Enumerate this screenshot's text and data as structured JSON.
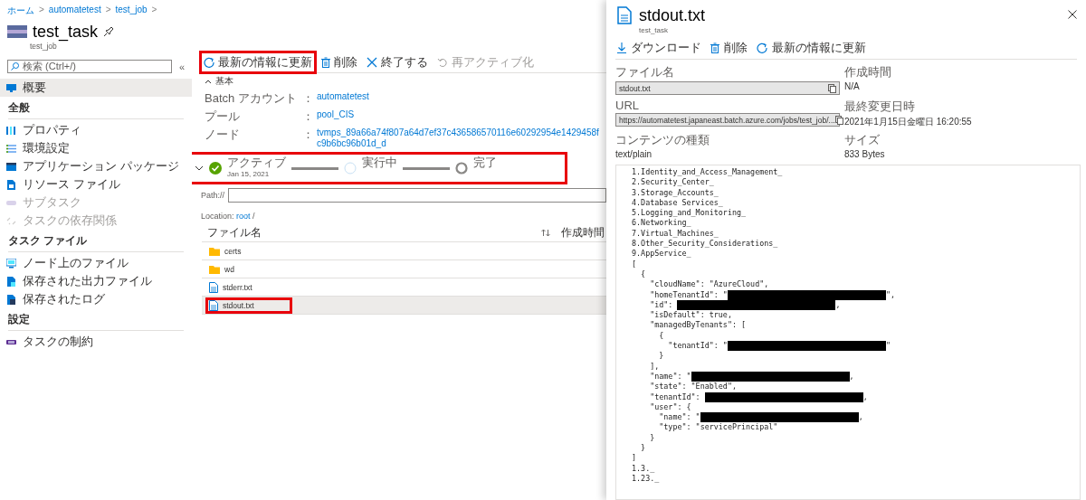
{
  "breadcrumb": [
    {
      "label": "ホーム",
      "separator": ">"
    },
    {
      "label": "automatetest",
      "separator": ">"
    },
    {
      "label": "test_job",
      "separator": ">"
    }
  ],
  "blade": {
    "title": "test_task",
    "subtitle": "test_job"
  },
  "sidebar": {
    "search_placeholder": "検索 (Ctrl+/)",
    "collapse": "«",
    "sections": [
      {
        "items": [
          {
            "label": "概要",
            "selected": true,
            "disabled": false
          }
        ]
      },
      {
        "heading": "全般",
        "items": [
          {
            "label": "プロパティ",
            "selected": false,
            "disabled": false
          },
          {
            "label": "環境設定",
            "selected": false,
            "disabled": false
          },
          {
            "label": "アプリケーション パッケージ",
            "selected": false,
            "disabled": false
          },
          {
            "label": "リソース ファイル",
            "selected": false,
            "disabled": false
          },
          {
            "label": "サブタスク",
            "selected": false,
            "disabled": true
          },
          {
            "label": "タスクの依存関係",
            "selected": false,
            "disabled": true
          }
        ]
      },
      {
        "heading": "タスク ファイル",
        "items": [
          {
            "label": "ノード上のファイル",
            "selected": false,
            "disabled": false
          },
          {
            "label": "保存された出力ファイル",
            "selected": false,
            "disabled": false
          },
          {
            "label": "保存されたログ",
            "selected": false,
            "disabled": false
          }
        ]
      },
      {
        "heading": "設定",
        "items": [
          {
            "label": "タスクの制約",
            "selected": false,
            "disabled": false
          }
        ]
      }
    ]
  },
  "main": {
    "toolbar": [
      {
        "label": "最新の情報に更新",
        "disabled": false,
        "highlighted": true
      },
      {
        "label": "削除",
        "disabled": false,
        "highlighted": false
      },
      {
        "label": "終了する",
        "disabled": false,
        "highlighted": false
      },
      {
        "label": "再アクティブ化",
        "disabled": true,
        "highlighted": false
      }
    ],
    "essentials": {
      "heading": "基本",
      "expanded": true,
      "fields": [
        {
          "label": "Batch アカウント",
          "separator": "：",
          "value": "automatetest"
        },
        {
          "label": "プール",
          "separator": "：",
          "value": "pool_CIS"
        },
        {
          "label": "ノード",
          "separator": "：",
          "value": "tvmps_89a66a74f807a64d7ef37c436586570116e60292954e1429458fc9b6bc96b01d_d"
        }
      ]
    },
    "status": {
      "expanded": false,
      "highlighted": true,
      "steps": [
        {
          "label": "アクティブ",
          "date": "Jan 15, 2021",
          "kind": "complete"
        },
        {
          "label": "実行中",
          "kind": "running"
        },
        {
          "label": "完了",
          "kind": "ring"
        }
      ]
    },
    "path": {
      "label": "Path://"
    },
    "location": {
      "label": "Location:",
      "link": "root",
      "suffix": "/"
    },
    "table": {
      "columns": [
        "ファイル名",
        "作成時間"
      ],
      "rows": [
        {
          "name": "certs",
          "kind": "folder",
          "selected": false,
          "highlighted": false
        },
        {
          "name": "wd",
          "kind": "folder",
          "selected": false,
          "highlighted": false
        },
        {
          "name": "stderr.txt",
          "kind": "file",
          "selected": false,
          "highlighted": false
        },
        {
          "name": "stdout.txt",
          "kind": "file",
          "selected": true,
          "highlighted": true
        }
      ]
    }
  },
  "panel": {
    "title": "stdout.txt",
    "subtitle": "test_task",
    "toolbar": [
      {
        "label": "ダウンロード"
      },
      {
        "label": "削除"
      },
      {
        "label": "最新の情報に更新"
      }
    ],
    "properties": [
      {
        "label": "ファイル名",
        "kind": "field",
        "value": "stdout.txt"
      },
      {
        "label": "作成時間",
        "kind": "text",
        "value": "N/A"
      },
      {
        "label": "URL",
        "kind": "field",
        "value": "https://automatetest.japaneast.batch.azure.com/jobs/test_job/..."
      },
      {
        "label": "最終変更日時",
        "kind": "text",
        "value": "2021年1月15日金曜日 16:20:55"
      },
      {
        "label": "コンテンツの種類",
        "kind": "text",
        "value": "text/plain"
      },
      {
        "label": "サイズ",
        "kind": "text",
        "value": "833 Bytes"
      }
    ],
    "content": [
      {
        "text": "1.Identity_and_Access_Management_",
        "redaction": false
      },
      {
        "text": "2.Security_Center_",
        "redaction": false
      },
      {
        "text": "3.Storage_Accounts_",
        "redaction": false
      },
      {
        "text": "4.Database Services_",
        "redaction": false
      },
      {
        "text": "5.Logging_and_Monitoring_",
        "redaction": false
      },
      {
        "text": "6.Networking_",
        "redaction": false
      },
      {
        "text": "7.Virtual_Machines_",
        "redaction": false
      },
      {
        "text": "8.Other_Security_Considerations_",
        "redaction": false
      },
      {
        "text": "9.AppService_",
        "redaction": false
      },
      {
        "text": "[",
        "redaction": false
      },
      {
        "text": "  {",
        "redaction": false
      },
      {
        "text": "    \"cloudName\": \"AzureCloud\",",
        "redaction": false
      },
      {
        "text": "    \"homeTenantId\": \"",
        "redaction": true,
        "tail": "\","
      },
      {
        "text": "    \"id\": ",
        "redaction": true,
        "tail": ","
      },
      {
        "text": "    \"isDefault\": true,",
        "redaction": false
      },
      {
        "text": "    \"managedByTenants\": [",
        "redaction": false
      },
      {
        "text": "      {",
        "redaction": false
      },
      {
        "text": "        \"tenantId\": \"",
        "redaction": true,
        "tail": "\""
      },
      {
        "text": "      }",
        "redaction": false
      },
      {
        "text": "    ],",
        "redaction": false
      },
      {
        "text": "    \"name\": \"",
        "redaction": true,
        "tail": ","
      },
      {
        "text": "    \"state\": \"Enabled\",",
        "redaction": false
      },
      {
        "text": "    \"tenantId\": ",
        "redaction": true,
        "tail": ","
      },
      {
        "text": "    \"user\": {",
        "redaction": false
      },
      {
        "text": "      \"name\": \"",
        "redaction": true,
        "tail": ","
      },
      {
        "text": "      \"type\": \"servicePrincipal\"",
        "redaction": false
      },
      {
        "text": "    }",
        "redaction": false
      },
      {
        "text": "  }",
        "redaction": false
      },
      {
        "text": "]",
        "redaction": false
      },
      {
        "text": "1.3._",
        "redaction": false
      },
      {
        "text": "1.23._",
        "redaction": false
      }
    ]
  }
}
